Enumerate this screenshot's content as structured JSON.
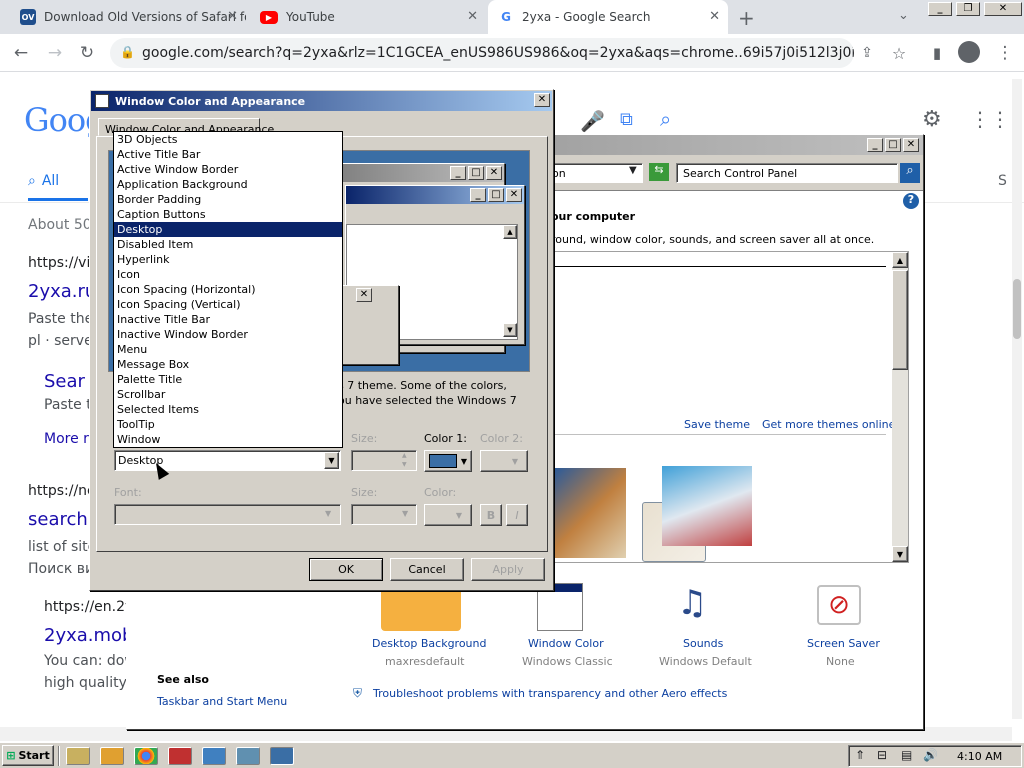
{
  "browser": {
    "tabs": [
      {
        "label": "Download Old Versions of Safari for",
        "favicon": "OV"
      },
      {
        "label": "YouTube"
      },
      {
        "label": "2yxa - Google Search"
      }
    ],
    "new_tab": "+",
    "url": "google.com/search?q=2yxa&rlz=1C1GCEA_enUS986US986&oq=2yxa&aqs=chrome..69i57j0i512l3j0i30i625l3j0i..."
  },
  "google": {
    "logo": "Goog",
    "tab_all": "All",
    "results_count": "About 50,",
    "results": [
      {
        "url": "https://vid",
        "title": "2yxa.ru",
        "snippet1": "Paste the",
        "snippet2": "pl · server"
      },
      {
        "url": "",
        "title": "Sear",
        "snippet1": "Paste t",
        "snippet2": ""
      },
      {
        "more": "More re"
      },
      {
        "url": "https://nex",
        "title": "search",
        "snippet1": "list of site",
        "snippet2": "Поиск ви"
      },
      {
        "url": "https://en.2y",
        "title": "2yxa.mob",
        "snippet1": "You can: dow",
        "snippet2": "high quality,;"
      }
    ],
    "side_letter": "S"
  },
  "dialog": {
    "title": "Window Color and Appearance",
    "tab": "Window Color and Appearance",
    "preview_text1": "s 7 theme.  Some of the colors,",
    "preview_text2": "ou have selected the Windows 7",
    "item_value": "Desktop",
    "size_label": "Size:",
    "color1_label": "Color 1:",
    "color1_value": "#3a6ea5",
    "color2_label": "Color 2:",
    "font_label": "Font:",
    "font_size_label": "Size:",
    "font_color_label": "Color:",
    "bold": "B",
    "italic": "I",
    "ok": "OK",
    "cancel": "Cancel",
    "apply": "Apply",
    "items": [
      "3D Objects",
      "Active Title Bar",
      "Active Window Border",
      "Application Background",
      "Border Padding",
      "Caption Buttons",
      "Desktop",
      "Disabled Item",
      "Hyperlink",
      "Icon",
      "Icon Spacing (Horizontal)",
      "Icon Spacing (Vertical)",
      "Inactive Title Bar",
      "Inactive Window Border",
      "Menu",
      "Message Box",
      "Palette Title",
      "Scrollbar",
      "Selected Items",
      "ToolTip",
      "Window"
    ],
    "selected_index": 6
  },
  "control_panel": {
    "address_tail": "on",
    "search_placeholder": "Search Control Panel",
    "heading": "our computer",
    "subtext": "round, window color, sounds, and screen saver all at once.",
    "save_theme": "Save theme",
    "more_themes": "Get more themes online",
    "settings": [
      {
        "label": "Desktop Background",
        "value": "maxresdefault"
      },
      {
        "label": "Window Color",
        "value": "Windows Classic"
      },
      {
        "label": "Sounds",
        "value": "Windows Default"
      },
      {
        "label": "Screen Saver",
        "value": "None"
      }
    ],
    "see_also": "See also",
    "taskbar_link": "Taskbar and Start Menu",
    "troubleshoot": "Troubleshoot problems with transparency and other Aero effects"
  },
  "taskbar": {
    "start": "Start",
    "clock": "4:10 AM"
  }
}
